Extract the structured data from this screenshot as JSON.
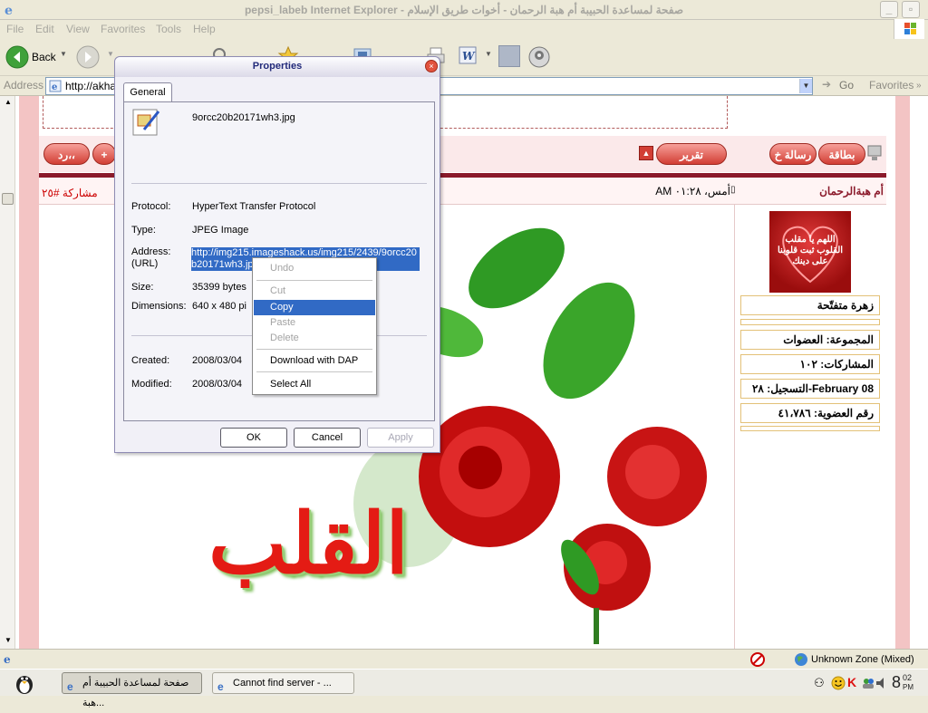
{
  "window": {
    "title": "pepsi_labeb Internet Explorer - صفحة لمساعدة الحبيبة أم هبة الرحمان - أخوات طريق الإسلام"
  },
  "menu": [
    "File",
    "Edit",
    "View",
    "Favorites",
    "Tools",
    "Help"
  ],
  "toolbar": {
    "back": "Back",
    "search": "Search",
    "favorites": "Favorites"
  },
  "address": {
    "label": "Address",
    "value": "http://akha",
    "go": "Go",
    "favorites": "Favorites"
  },
  "forum": {
    "reply_button": "رد،،",
    "quote_button": "+",
    "report_button": "تقرير",
    "card_button": "بطاقة",
    "pm_button": "رسالة خ",
    "post_number": "مشاركة #٢٥",
    "post_time": "أمس، ٠١:٢٨ AM",
    "author": "أم هبةالرحمان",
    "avatar_text": "اللهم يا مقلب القلوب ثبت قلوبنا على دينك",
    "profile": [
      "زهرة متفتّحة",
      "",
      "المجموعة: العضوات",
      "المشاركات: ١٠٢",
      "التسجيل: ٢٨-February 08",
      "رقم العضوية: ٤١،٧٨٦"
    ],
    "image_caption": "القلب"
  },
  "dialog": {
    "title": "Properties",
    "tab": "General",
    "filename": "9orcc20b20171wh3.jpg",
    "protocol_label": "Protocol:",
    "protocol": "HyperText Transfer Protocol",
    "type_label": "Type:",
    "type": "JPEG Image",
    "address_label": "Address:\n(URL)",
    "address": "http://img215.imageshack.us/img215/2439/9orcc20b20171wh3.jpg",
    "size_label": "Size:",
    "size": "35399 bytes",
    "dimensions_label": "Dimensions:",
    "dimensions": "640 x 480 pi",
    "created_label": "Created:",
    "created": "2008/03/04",
    "modified_label": "Modified:",
    "modified": "2008/03/04",
    "ok": "OK",
    "cancel": "Cancel",
    "apply": "Apply"
  },
  "context_menu": [
    "Undo",
    "Cut",
    "Copy",
    "Paste",
    "Delete",
    "Download with DAP",
    "Select All"
  ],
  "status": {
    "zone": "Unknown Zone (Mixed)"
  },
  "taskbar": {
    "tasks": [
      "صفحة لمساعدة الحبيبة أم هبة...",
      "Cannot find server - ..."
    ],
    "clock_hour": "8",
    "clock_min": "02",
    "clock_ampm": "PM"
  },
  "colors": {
    "accent": "#316ac5",
    "forum_red": "#d23e34",
    "maroon": "#8b1a2b"
  }
}
